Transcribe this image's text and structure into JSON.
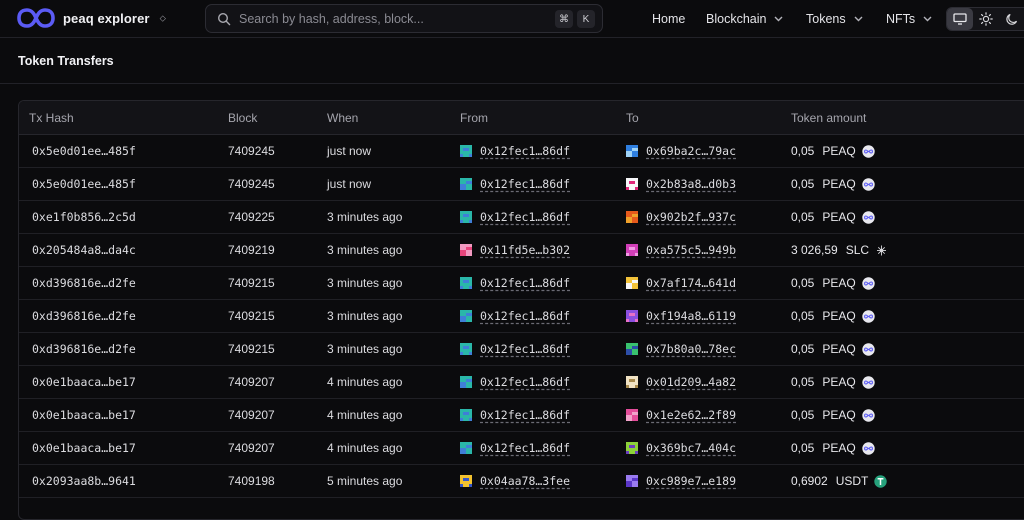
{
  "header": {
    "brand": "peaq explorer",
    "search_placeholder": "Search by hash, address, block...",
    "kbd_cmd": "⌘",
    "kbd_key": "K",
    "nav": [
      {
        "label": "Home",
        "dropdown": false
      },
      {
        "label": "Blockchain",
        "dropdown": true
      },
      {
        "label": "Tokens",
        "dropdown": true
      },
      {
        "label": "NFTs",
        "dropdown": true
      }
    ],
    "theme_active": "system"
  },
  "page": {
    "title": "Token Transfers"
  },
  "table": {
    "columns": [
      "Tx Hash",
      "Block",
      "When",
      "From",
      "To",
      "Token amount"
    ],
    "rows": [
      {
        "tx": "0x5e0d01ee…485f",
        "block": "7409245",
        "when": "just now",
        "from": "0x12fec1…86df",
        "to": "0x69ba2c…79ac",
        "amount": "0,05",
        "token": "PEAQ",
        "from_icon": "teal",
        "to_icon": "blue"
      },
      {
        "tx": "0x5e0d01ee…485f",
        "block": "7409245",
        "when": "just now",
        "from": "0x12fec1…86df",
        "to": "0x2b83a8…d0b3",
        "amount": "0,05",
        "token": "PEAQ",
        "from_icon": "teal",
        "to_icon": "pink"
      },
      {
        "tx": "0xe1f0b856…2c5d",
        "block": "7409225",
        "when": "3 minutes ago",
        "from": "0x12fec1…86df",
        "to": "0x902b2f…937c",
        "amount": "0,05",
        "token": "PEAQ",
        "from_icon": "teal",
        "to_icon": "orange"
      },
      {
        "tx": "0x205484a8…da4c",
        "block": "7409219",
        "when": "3 minutes ago",
        "from": "0x11fd5e…b302",
        "to": "0xa575c5…949b",
        "amount": "3 026,59",
        "token": "SLC",
        "from_icon": "rose",
        "to_icon": "magenta"
      },
      {
        "tx": "0xd396816e…d2fe",
        "block": "7409215",
        "when": "3 minutes ago",
        "from": "0x12fec1…86df",
        "to": "0x7af174…641d",
        "amount": "0,05",
        "token": "PEAQ",
        "from_icon": "teal",
        "to_icon": "yellow"
      },
      {
        "tx": "0xd396816e…d2fe",
        "block": "7409215",
        "when": "3 minutes ago",
        "from": "0x12fec1…86df",
        "to": "0xf194a8…6119",
        "amount": "0,05",
        "token": "PEAQ",
        "from_icon": "teal",
        "to_icon": "violet"
      },
      {
        "tx": "0xd396816e…d2fe",
        "block": "7409215",
        "when": "3 minutes ago",
        "from": "0x12fec1…86df",
        "to": "0x7b80a0…78ec",
        "amount": "0,05",
        "token": "PEAQ",
        "from_icon": "teal",
        "to_icon": "green"
      },
      {
        "tx": "0x0e1baaca…be17",
        "block": "7409207",
        "when": "4 minutes ago",
        "from": "0x12fec1…86df",
        "to": "0x01d209…4a82",
        "amount": "0,05",
        "token": "PEAQ",
        "from_icon": "teal",
        "to_icon": "cream"
      },
      {
        "tx": "0x0e1baaca…be17",
        "block": "7409207",
        "when": "4 minutes ago",
        "from": "0x12fec1…86df",
        "to": "0x1e2e62…2f89",
        "amount": "0,05",
        "token": "PEAQ",
        "from_icon": "teal",
        "to_icon": "fuchsia"
      },
      {
        "tx": "0x0e1baaca…be17",
        "block": "7409207",
        "when": "4 minutes ago",
        "from": "0x12fec1…86df",
        "to": "0x369bc7…404c",
        "amount": "0,05",
        "token": "PEAQ",
        "from_icon": "teal",
        "to_icon": "lime"
      },
      {
        "tx": "0x2093aa8b…9641",
        "block": "7409198",
        "when": "5 minutes ago",
        "from": "0x04aa78…3fee",
        "to": "0xc989e7…e189",
        "amount": "0,6902",
        "token": "USDT",
        "from_icon": "gold",
        "to_icon": "lavender"
      }
    ]
  },
  "colors": {
    "brand": "#5b5bf5",
    "peaq_token": "#e8e8ee",
    "usdt_token": "#26a17b",
    "identicons": {
      "teal": [
        "#2ab7a9",
        "#3f7fd8"
      ],
      "blue": [
        "#2f7fe0",
        "#9fd3f7"
      ],
      "pink": [
        "#f7f7f9",
        "#e0287a"
      ],
      "orange": [
        "#e65a1c",
        "#f0a12a"
      ],
      "rose": [
        "#f29ac1",
        "#e8457c"
      ],
      "magenta": [
        "#d23fb8",
        "#f19ae3"
      ],
      "yellow": [
        "#f3c33a",
        "#f7f7f9"
      ],
      "violet": [
        "#8a4fe0",
        "#e870c9"
      ],
      "green": [
        "#39c26f",
        "#2d4ea8"
      ],
      "cream": [
        "#f1e3c4",
        "#a88a4d"
      ],
      "fuchsia": [
        "#e44d9a",
        "#f2a3cb"
      ],
      "lime": [
        "#8dd13a",
        "#6b3fbf"
      ],
      "gold": [
        "#f2c230",
        "#3556c9"
      ],
      "lavender": [
        "#9a7bf0",
        "#5a36c8"
      ]
    }
  },
  "icons": {
    "search": "magnifier-icon",
    "system_theme": "monitor-icon",
    "light_theme": "sun-icon",
    "dark_theme": "moon-icon"
  }
}
